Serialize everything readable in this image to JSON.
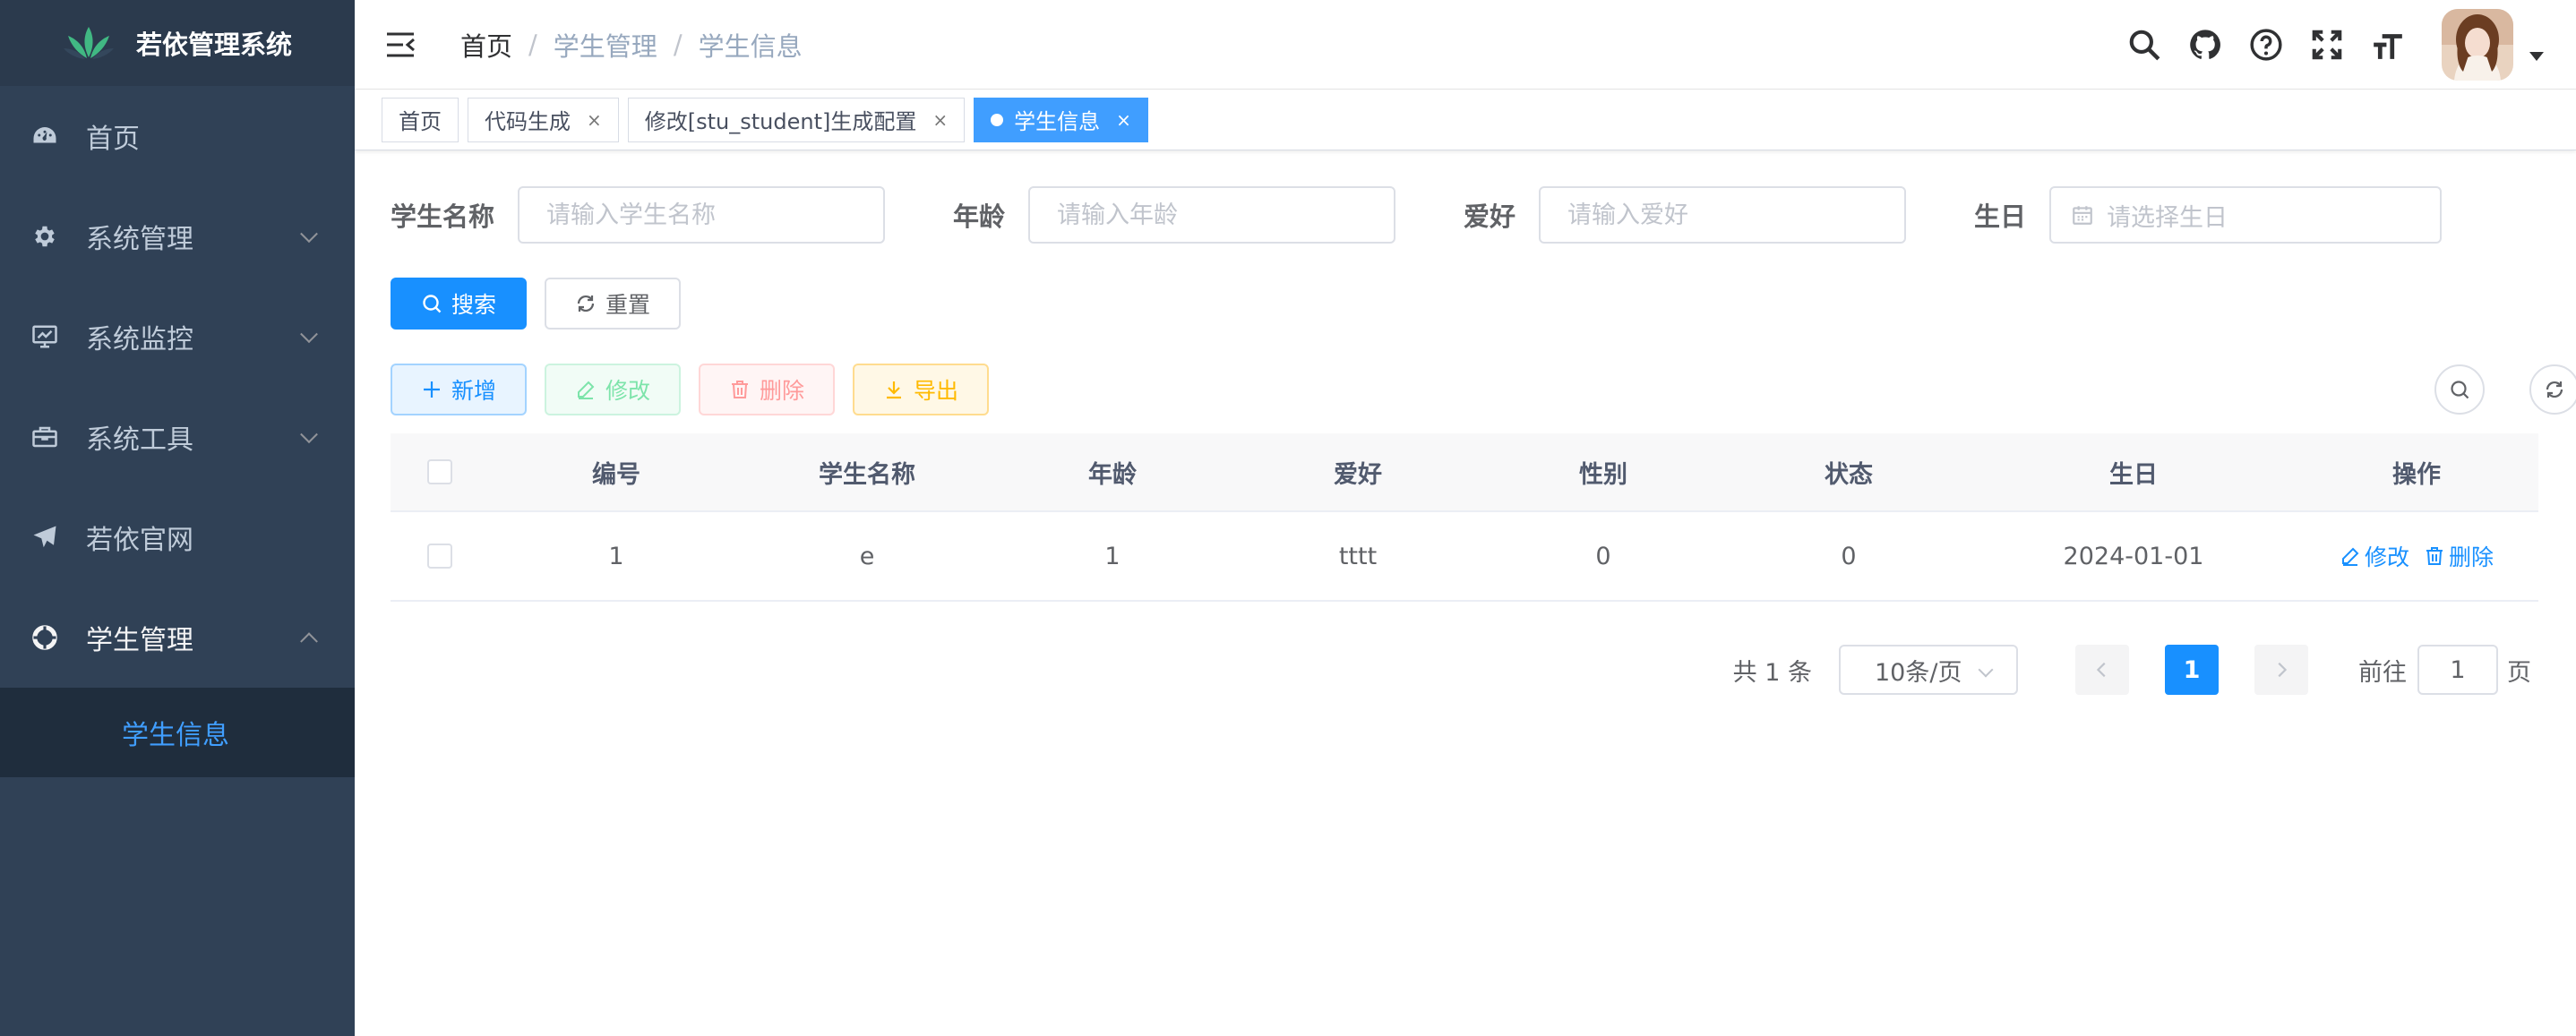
{
  "app": {
    "title": "若依管理系统"
  },
  "sidebar": {
    "items": [
      {
        "label": "首页"
      },
      {
        "label": "系统管理"
      },
      {
        "label": "系统监控"
      },
      {
        "label": "系统工具"
      },
      {
        "label": "若依官网"
      },
      {
        "label": "学生管理"
      }
    ],
    "submenu": [
      {
        "label": "学生信息"
      }
    ]
  },
  "breadcrumb": [
    "首页",
    "学生管理",
    "学生信息"
  ],
  "breadcrumb_sep": "/",
  "tags": [
    {
      "label": "首页",
      "closable": false
    },
    {
      "label": "代码生成",
      "close": "×"
    },
    {
      "label": "修改[stu_student]生成配置",
      "close": "×"
    },
    {
      "label": "学生信息",
      "close": "×",
      "active": true
    }
  ],
  "search_form": {
    "name": {
      "label": "学生名称",
      "placeholder": "请输入学生名称"
    },
    "age": {
      "label": "年龄",
      "placeholder": "请输入年龄"
    },
    "hobby": {
      "label": "爱好",
      "placeholder": "请输入爱好"
    },
    "birthday": {
      "label": "生日",
      "placeholder": "请选择生日"
    },
    "search_label": "搜索",
    "reset_label": "重置"
  },
  "toolbar": {
    "add_label": "新增",
    "edit_label": "修改",
    "delete_label": "删除",
    "export_label": "导出"
  },
  "table": {
    "columns": [
      "编号",
      "学生名称",
      "年龄",
      "爱好",
      "性别",
      "状态",
      "生日",
      "操作"
    ],
    "rows": [
      {
        "id": "1",
        "name": "e",
        "age": "1",
        "hobby": "tttt",
        "gender": "0",
        "status": "0",
        "birthday": "2024-01-01"
      }
    ],
    "row_edit_label": "修改",
    "row_delete_label": "删除"
  },
  "pagination": {
    "total_text": "共 1 条",
    "page_size": "10条/页",
    "current_page": "1",
    "goto_prefix": "前往",
    "goto_value": "1",
    "goto_suffix": "页"
  },
  "colors": {
    "sidebar_bg": "#304156",
    "primary": "#1890ff",
    "active_tag": "#409eff"
  }
}
